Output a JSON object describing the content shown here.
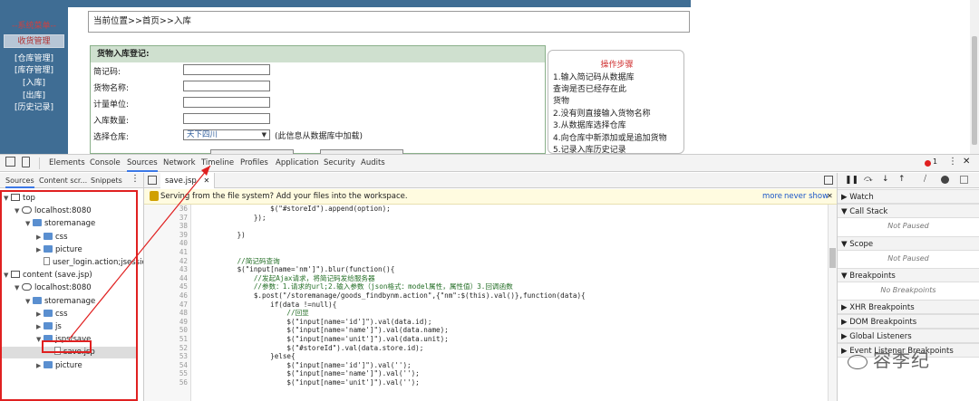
{
  "nav": {
    "title": "--系统菜单--",
    "active": "收货管理",
    "items": [
      "[仓库管理]",
      "[库存管理]",
      "[入库]",
      "[出库]",
      "[历史记录]"
    ]
  },
  "breadcrumb": "当前位置>>首页>>入库",
  "form": {
    "header": "货物入库登记:",
    "labels": [
      "简记码:",
      "货物名称:",
      "计量单位:",
      "入库数量:",
      "选择仓库:"
    ],
    "select_value": "天下四川",
    "select_note": "(此信息从数据库中加载)"
  },
  "steps": {
    "title": "操作步骤",
    "lines": [
      "1.输入简记码从数据库",
      "查询是否已经存在此",
      "货物",
      "2.没有则直接输入货物名称",
      "3.从数据库选择仓库",
      "4.向仓库中新添加或是追加货物",
      "5.记录入库历史记录"
    ]
  },
  "devtools": {
    "tabs": [
      "Elements",
      "Console",
      "Sources",
      "Network",
      "Timeline",
      "Profiles",
      "Application",
      "Security",
      "Audits"
    ],
    "badge": "1",
    "subtabs": [
      "Sources",
      "Content scr...",
      "Snippets"
    ],
    "tree": [
      {
        "label": "top",
        "type": "frame",
        "depth": 0,
        "tw": "▼"
      },
      {
        "label": "localhost:8080",
        "type": "cloud",
        "depth": 1,
        "tw": "▼"
      },
      {
        "label": "storemanage",
        "type": "folder",
        "depth": 2,
        "tw": "▼"
      },
      {
        "label": "css",
        "type": "folder",
        "depth": 3,
        "tw": "▶"
      },
      {
        "label": "picture",
        "type": "folder",
        "depth": 3,
        "tw": "▶"
      },
      {
        "label": "user_login.action;jsessionid=",
        "type": "file",
        "depth": 3,
        "tw": ""
      },
      {
        "label": "content (save.jsp)",
        "type": "frame",
        "depth": 0,
        "tw": "▼"
      },
      {
        "label": "localhost:8080",
        "type": "cloud",
        "depth": 1,
        "tw": "▼"
      },
      {
        "label": "storemanage",
        "type": "folder",
        "depth": 2,
        "tw": "▼"
      },
      {
        "label": "css",
        "type": "folder",
        "depth": 3,
        "tw": "▶"
      },
      {
        "label": "js",
        "type": "folder",
        "depth": 3,
        "tw": "▶"
      },
      {
        "label": "jsps/save",
        "type": "folder",
        "depth": 3,
        "tw": "▼"
      },
      {
        "label": "save.jsp",
        "type": "file",
        "depth": 4,
        "tw": ""
      },
      {
        "label": "picture",
        "type": "folder",
        "depth": 3,
        "tw": "▶"
      }
    ],
    "editor_tab": "save.jsp",
    "infobar": {
      "text": "Serving from the file system? Add your files into the workspace.",
      "more": "more",
      "never": "never show"
    },
    "code": [
      {
        "n": "36",
        "t": "                $(\"#storeId\").append(option);"
      },
      {
        "n": "37",
        "t": "            });"
      },
      {
        "n": "38",
        "t": ""
      },
      {
        "n": "39",
        "t": "        })"
      },
      {
        "n": "40",
        "t": ""
      },
      {
        "n": "41",
        "t": ""
      },
      {
        "n": "42",
        "t": "        //简记码查询"
      },
      {
        "n": "43",
        "t": "        $(\"input[name='nm']\").blur(function(){"
      },
      {
        "n": "44",
        "t": "            //发起Ajax请求，将简记码发给服务器"
      },
      {
        "n": "45",
        "t": "            //参数：1.请求的url;2.输入参数（json格式：model属性，属性值）3.回调函数"
      },
      {
        "n": "46",
        "t": "            $.post(\"/storemanage/goods_findbynm.action\",{\"nm\":$(this).val()},function(data){"
      },
      {
        "n": "47",
        "t": "                if(data !=null){"
      },
      {
        "n": "48",
        "t": "                    //回显"
      },
      {
        "n": "49",
        "t": "                    $(\"input[name='id']\").val(data.id);"
      },
      {
        "n": "50",
        "t": "                    $(\"input[name='name']\").val(data.name);"
      },
      {
        "n": "51",
        "t": "                    $(\"input[name='unit']\").val(data.unit);"
      },
      {
        "n": "52",
        "t": "                    $(\"#storeId\").val(data.store.id);"
      },
      {
        "n": "53",
        "t": "                }else{"
      },
      {
        "n": "54",
        "t": "                    $(\"input[name='id']\").val('');"
      },
      {
        "n": "55",
        "t": "                    $(\"input[name='name']\").val('');"
      },
      {
        "n": "56",
        "t": "                    $(\"input[name='unit']\").val('');"
      }
    ],
    "right": {
      "watch": "Watch",
      "call_stack": "Call Stack",
      "not_paused": "Not Paused",
      "scope": "Scope",
      "breakpoints": "Breakpoints",
      "no_breakpoints": "No Breakpoints",
      "xhr": "XHR Breakpoints",
      "dom": "DOM Breakpoints",
      "global": "Global Listeners",
      "event": "Event Listener Breakpoints"
    }
  },
  "watermark": "容李纪",
  "colors": {
    "nav_bg": "#3f6d94",
    "highlight": "#e02020",
    "accent": "#3b78e7"
  }
}
